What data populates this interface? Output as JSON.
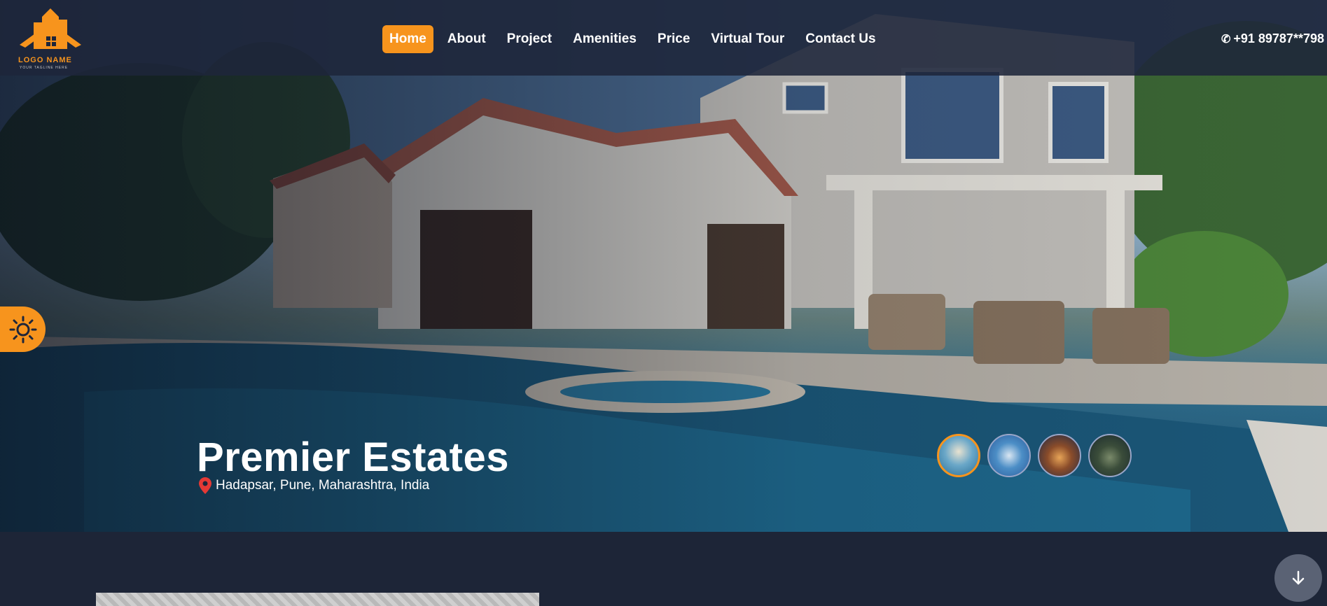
{
  "brand": {
    "logo_text": "LOGO NAME",
    "logo_tagline": "YOUR TAGLINE HERE",
    "accent_color": "#f7941d"
  },
  "nav": {
    "items": [
      {
        "label": "Home",
        "active": true
      },
      {
        "label": "About",
        "active": false
      },
      {
        "label": "Project",
        "active": false
      },
      {
        "label": "Amenities",
        "active": false
      },
      {
        "label": "Price",
        "active": false
      },
      {
        "label": "Virtual Tour",
        "active": false
      },
      {
        "label": "Contact Us",
        "active": false
      }
    ]
  },
  "contact": {
    "phone": "+91 89787**798",
    "icon": "phone-icon"
  },
  "hero": {
    "title": "Premier Estates",
    "location": "Hadapsar, Pune, Maharashtra, India",
    "location_icon": "map-pin-icon",
    "thumbnails": [
      {
        "icon": "pool-house-thumbnail",
        "active": true
      },
      {
        "icon": "pool-deck-thumbnail",
        "active": false
      },
      {
        "icon": "villa-night-thumbnail",
        "active": false
      },
      {
        "icon": "garden-villa-thumbnail",
        "active": false
      }
    ]
  },
  "controls": {
    "theme_toggle_icon": "sun-icon",
    "scroll_down_icon": "arrow-down-icon"
  }
}
